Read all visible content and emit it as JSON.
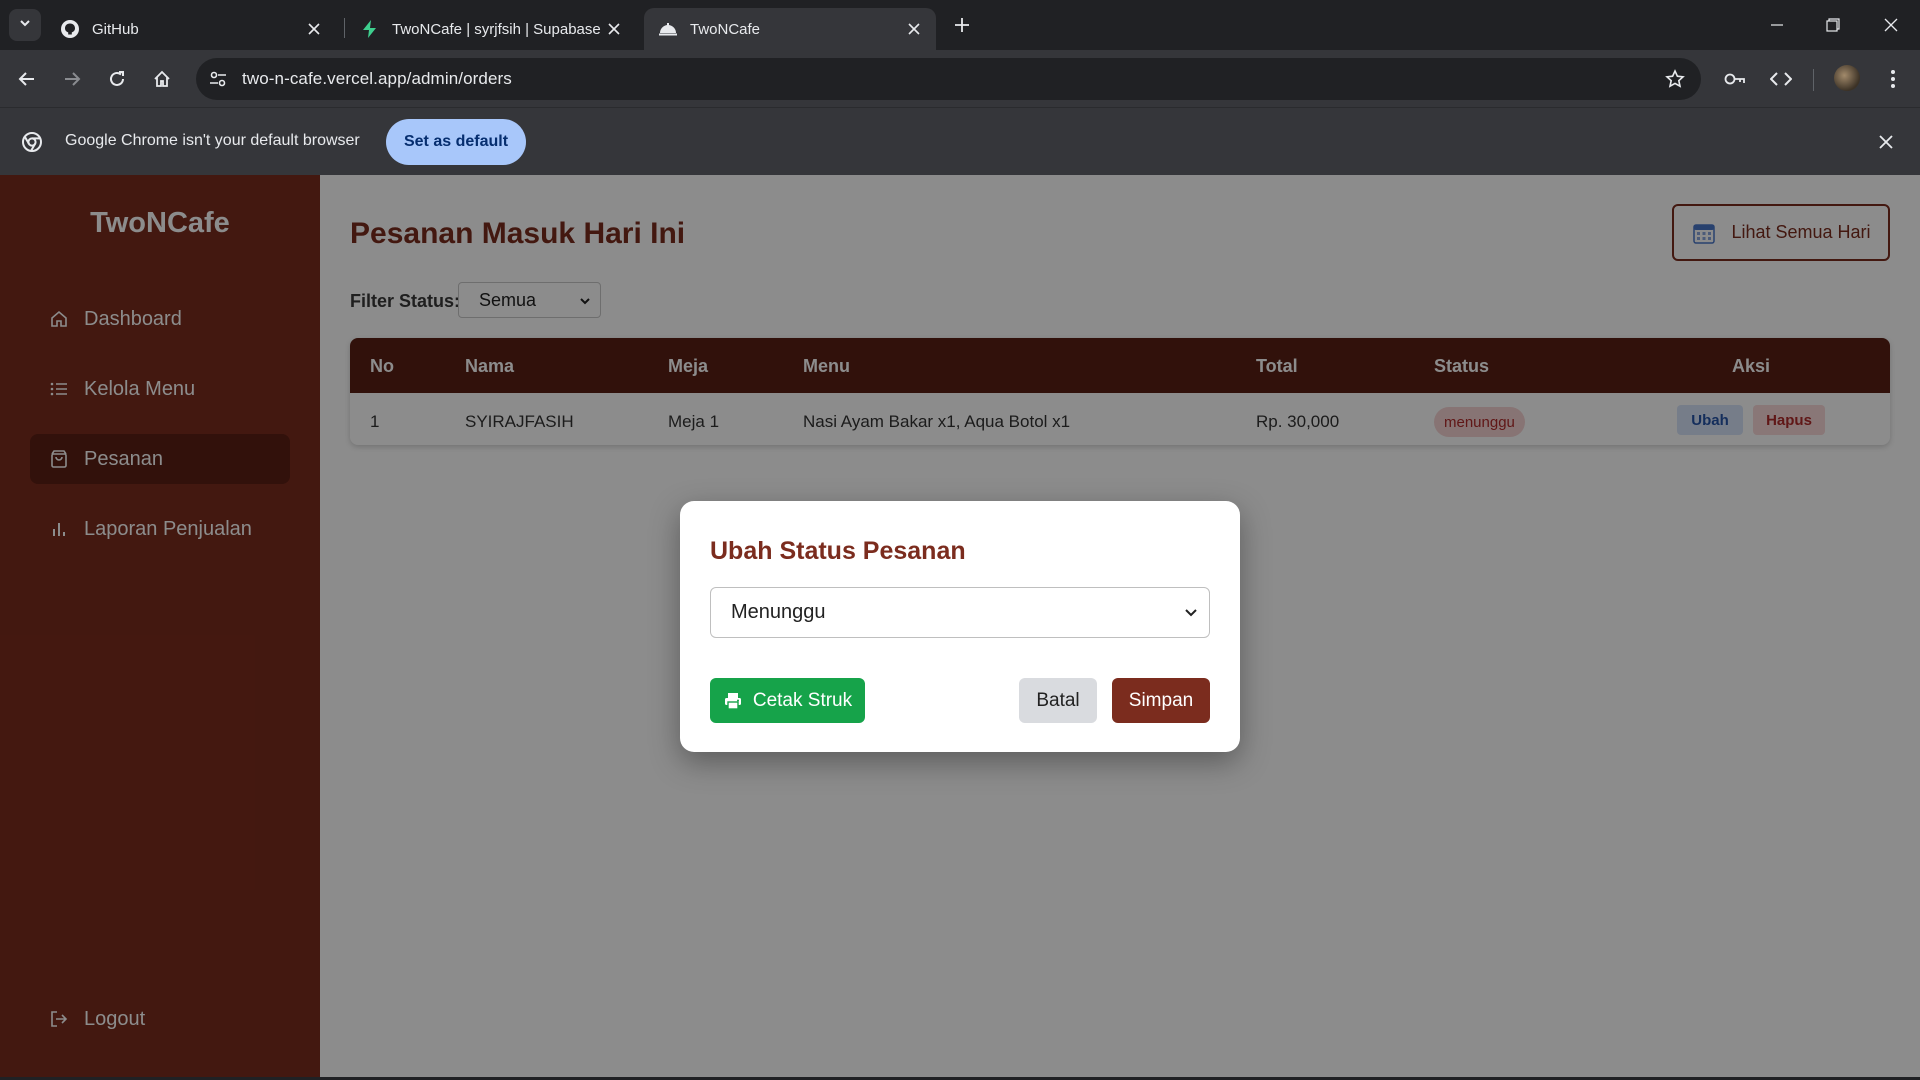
{
  "browser": {
    "tabs": [
      {
        "title": "GitHub",
        "icon": "github-icon"
      },
      {
        "title": "TwoNCafe | syrjfsih | Supabase",
        "icon": "supabase-icon"
      },
      {
        "title": "TwoNCafe",
        "icon": "cloche-icon",
        "active": true
      }
    ],
    "url": "two-n-cafe.vercel.app/admin/orders",
    "infobar": {
      "message": "Google Chrome isn't your default browser",
      "button": "Set as default"
    }
  },
  "sidebar": {
    "brand": "TwoNCafe",
    "items": [
      {
        "label": "Dashboard",
        "icon": "home-icon"
      },
      {
        "label": "Kelola Menu",
        "icon": "list-icon"
      },
      {
        "label": "Pesanan",
        "icon": "bag-icon",
        "active": true
      },
      {
        "label": "Laporan Penjualan",
        "icon": "bar-chart-icon"
      }
    ],
    "logout": "Logout"
  },
  "main": {
    "title": "Pesanan Masuk Hari Ini",
    "all_days_button": "Lihat Semua Hari",
    "filter": {
      "label": "Filter Status:",
      "value": "Semua"
    },
    "table": {
      "headers": [
        "No",
        "Nama",
        "Meja",
        "Menu",
        "Total",
        "Status",
        "Aksi"
      ],
      "rows": [
        {
          "no": "1",
          "nama": "SYIRAJFASIH",
          "meja": "Meja 1",
          "menu": "Nasi Ayam Bakar x1, Aqua Botol x1",
          "total": "Rp. 30,000",
          "status": "menunggu",
          "edit": "Ubah",
          "delete": "Hapus"
        }
      ]
    }
  },
  "modal": {
    "title": "Ubah Status Pesanan",
    "select_value": "Menunggu",
    "print_button": "Cetak Struk",
    "cancel_button": "Batal",
    "save_button": "Simpan"
  },
  "colors": {
    "brand": "#7b2c1e",
    "table_header": "#5a1f15",
    "print_green": "#16a34a"
  }
}
